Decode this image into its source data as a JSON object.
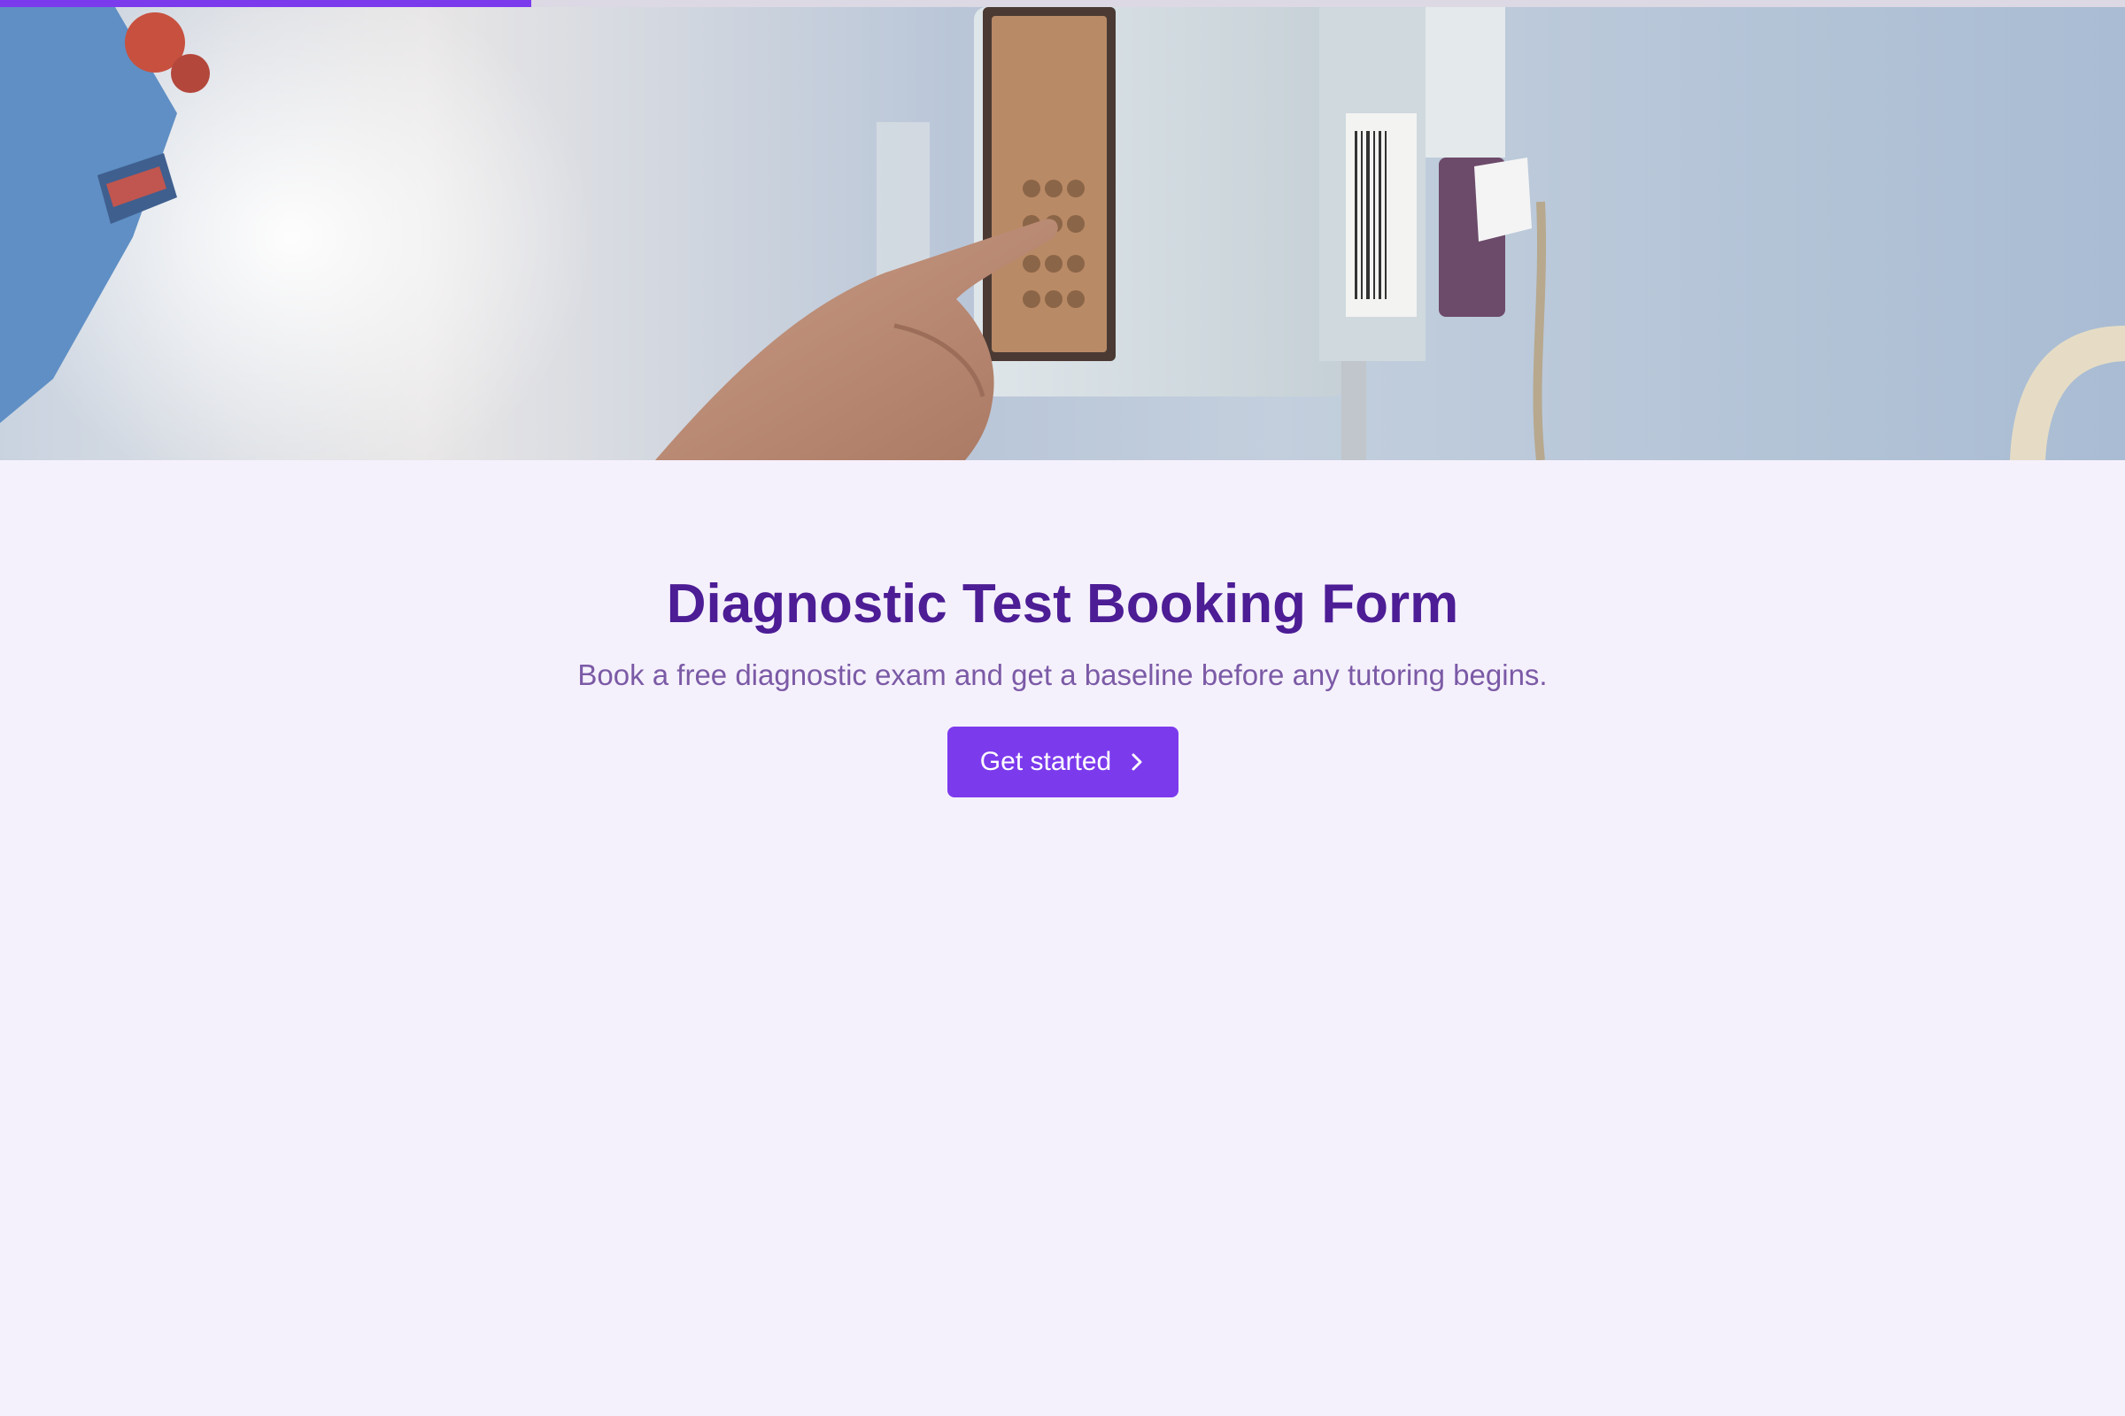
{
  "progress": {
    "value_percent": 25
  },
  "hero": {
    "image": "nurse-hand-pressing-infusion-pump-keypad"
  },
  "main": {
    "title": "Diagnostic Test Booking Form",
    "subtitle": "Book a free diagnostic exam and get a baseline before any tutoring begins.",
    "cta_label": "Get started",
    "cta_icon": "chevron-right-icon"
  },
  "colors": {
    "accent": "#7c3aed",
    "title": "#4c1d95",
    "subtitle": "#7b5aa6",
    "background": "#f5f1fc"
  }
}
